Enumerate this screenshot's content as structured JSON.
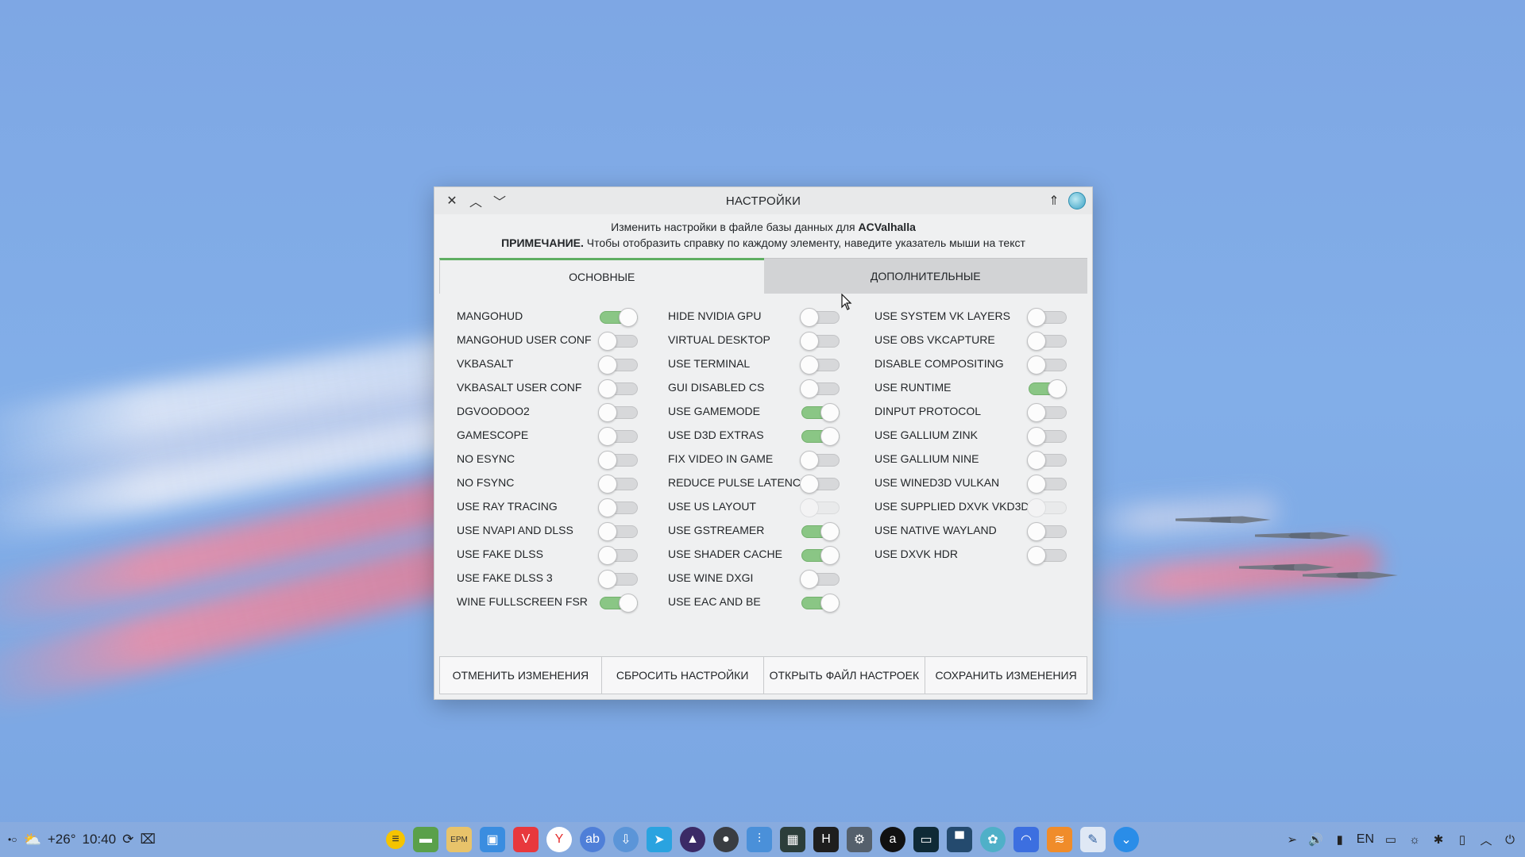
{
  "window": {
    "title": "НАСТРОЙКИ",
    "info_line1_prefix": "Изменить настройки в файле базы данных для",
    "info_line1_game": "ACValhalla",
    "info_line2_bold": "ПРИМЕЧАНИЕ.",
    "info_line2_text": " Чтобы отобразить справку по каждому элементу, наведите указатель мыши на текст"
  },
  "tabs": [
    {
      "label": "ОСНОВНЫЕ",
      "active": true
    },
    {
      "label": "ДОПОЛНИТЕЛЬНЫЕ",
      "active": false
    }
  ],
  "options": {
    "col1": [
      {
        "label": "MANGOHUD",
        "state": "on"
      },
      {
        "label": "MANGOHUD USER CONF",
        "state": "off"
      },
      {
        "label": "VKBASALT",
        "state": "off"
      },
      {
        "label": "VKBASALT USER CONF",
        "state": "off"
      },
      {
        "label": "DGVOODOO2",
        "state": "off"
      },
      {
        "label": "GAMESCOPE",
        "state": "off"
      },
      {
        "label": "NO ESYNC",
        "state": "off"
      },
      {
        "label": "NO FSYNC",
        "state": "off"
      },
      {
        "label": "USE RAY TRACING",
        "state": "off"
      },
      {
        "label": "USE NVAPI AND DLSS",
        "state": "off"
      },
      {
        "label": "USE FAKE DLSS",
        "state": "off"
      },
      {
        "label": "USE FAKE DLSS 3",
        "state": "off"
      },
      {
        "label": "WINE FULLSCREEN FSR",
        "state": "on"
      }
    ],
    "col2": [
      {
        "label": "HIDE NVIDIA GPU",
        "state": "off"
      },
      {
        "label": "VIRTUAL DESKTOP",
        "state": "off"
      },
      {
        "label": "USE TERMINAL",
        "state": "off"
      },
      {
        "label": "GUI DISABLED CS",
        "state": "off"
      },
      {
        "label": "USE GAMEMODE",
        "state": "on"
      },
      {
        "label": "USE D3D EXTRAS",
        "state": "on"
      },
      {
        "label": "FIX VIDEO IN GAME",
        "state": "off"
      },
      {
        "label": "REDUCE PULSE LATENCY",
        "state": "off"
      },
      {
        "label": "USE US LAYOUT",
        "state": "disabled"
      },
      {
        "label": "USE GSTREAMER",
        "state": "on"
      },
      {
        "label": "USE SHADER CACHE",
        "state": "on"
      },
      {
        "label": "USE WINE DXGI",
        "state": "off"
      },
      {
        "label": "USE EAC AND BE",
        "state": "on"
      }
    ],
    "col3": [
      {
        "label": "USE SYSTEM VK LAYERS",
        "state": "off"
      },
      {
        "label": "USE OBS VKCAPTURE",
        "state": "off"
      },
      {
        "label": "DISABLE COMPOSITING",
        "state": "off"
      },
      {
        "label": "USE RUNTIME",
        "state": "on"
      },
      {
        "label": "DINPUT PROTOCOL",
        "state": "off"
      },
      {
        "label": "USE GALLIUM ZINK",
        "state": "off"
      },
      {
        "label": "USE GALLIUM NINE",
        "state": "off"
      },
      {
        "label": "USE WINED3D VULKAN",
        "state": "off"
      },
      {
        "label": "USE SUPPLIED DXVK VKD3D",
        "state": "disabled"
      },
      {
        "label": "USE NATIVE WAYLAND",
        "state": "off"
      },
      {
        "label": "USE DXVK HDR",
        "state": "off"
      }
    ]
  },
  "buttons": {
    "cancel": "ОТМЕНИТЬ ИЗМЕНЕНИЯ",
    "reset": "СБРОСИТЬ НАСТРОЙКИ",
    "open": "ОТКРЫТЬ ФАЙЛ НАСТРОЕК",
    "save": "СОХРАНИТЬ ИЗМЕНЕНИЯ"
  },
  "taskbar": {
    "temperature": "+26°",
    "time": "10:40",
    "language": "EN"
  },
  "colors": {
    "toggle_on": "#8ac685",
    "tab_accent": "#5fae62"
  }
}
